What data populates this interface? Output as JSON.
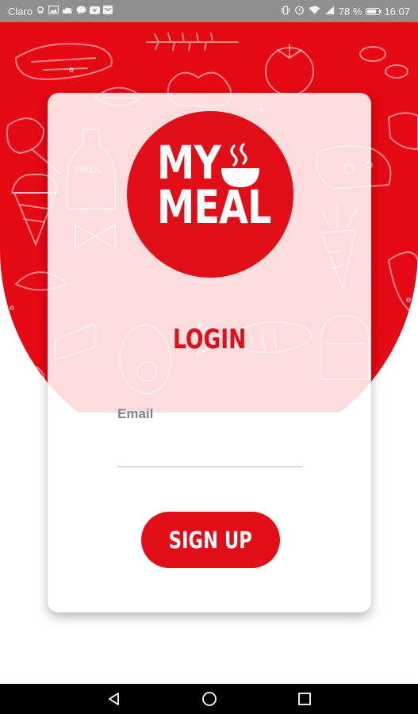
{
  "status_bar": {
    "carrier": "Claro",
    "battery_percent": "78 %",
    "battery_level": 0.78,
    "time": "16:07",
    "left_icons": [
      "usb-debug-icon",
      "image-icon",
      "cloud-icon",
      "chat-bubble-icon",
      "youtube-icon",
      "email-icon"
    ],
    "right_icons": [
      "vibrate-icon",
      "alarm-icon",
      "wifi-icon",
      "signal-icon",
      "battery-icon"
    ]
  },
  "logo": {
    "line1": "MY",
    "line2": "MEAL",
    "icon": "steaming-bowl-icon"
  },
  "login": {
    "title": "LOGIN",
    "email_label": "Email",
    "email_value": "",
    "signup_label": "SIGN UP"
  },
  "nav_bar": {
    "buttons": [
      "back-icon",
      "home-icon",
      "recents-icon"
    ]
  },
  "colors": {
    "accent": "#e20e17",
    "hero_bg": "#e50914",
    "status_bar": "#8f8f8f",
    "nav_bar": "#000000",
    "label": "#7f878f"
  }
}
